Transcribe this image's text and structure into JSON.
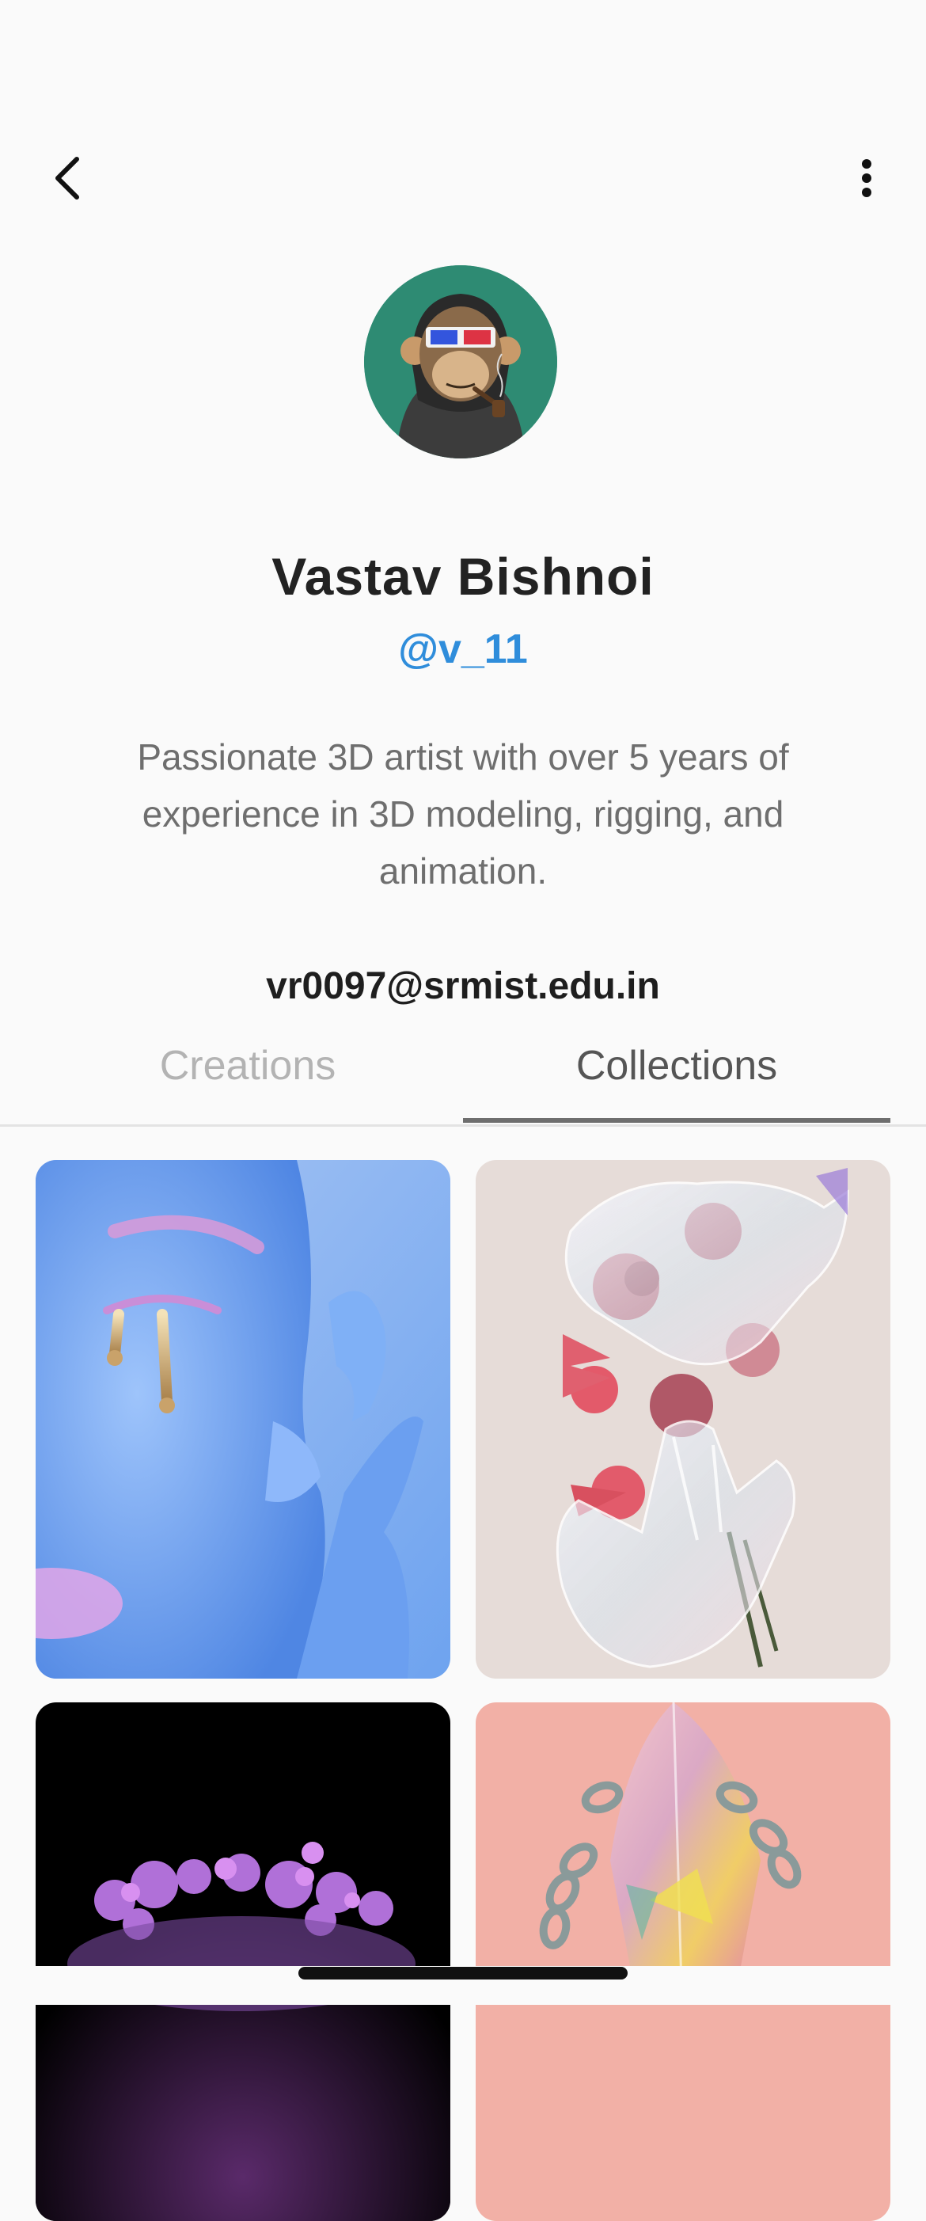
{
  "header": {
    "back_icon": "chevron-left-icon",
    "more_icon": "vertical-ellipsis-icon"
  },
  "profile": {
    "avatar_icon": "ape-avatar",
    "name": "Vastav Bishnoi",
    "handle": "@v_11",
    "bio": "Passionate 3D artist with over 5 years of experience in 3D modeling, rigging, and animation.",
    "email": "vr0097@srmist.edu.in"
  },
  "tabs": [
    {
      "label": "Creations",
      "active": false
    },
    {
      "label": "Collections",
      "active": true
    }
  ],
  "colors": {
    "accent": "#2f8ddb",
    "avatar_bg": "#2e8b73",
    "tab_active": "#555555",
    "tab_inactive": "#b3b3b3"
  },
  "collections": [
    {
      "subject": "blue-face-gold-tears"
    },
    {
      "subject": "glass-hands-roses"
    },
    {
      "subject": "purple-flowers-dark"
    },
    {
      "subject": "crystal-chains-pink"
    }
  ]
}
